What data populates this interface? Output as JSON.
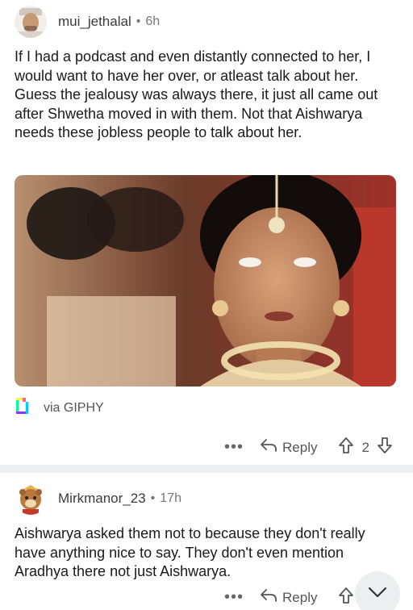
{
  "comments": [
    {
      "username": "mui_jethalal",
      "separator": "•",
      "age": "6h",
      "body": "If I had a podcast and even distantly connected to her, I would want to have her over, or atleast talk about her. Guess the jealousy was always there, it just all came out after Shwetha moved in with them. Not that Aishwarya needs these jobless people to talk about her.",
      "attachment_label": "via GIPHY",
      "more_label": "•••",
      "reply_label": "Reply",
      "vote_count": "2"
    },
    {
      "username": "Mirkmanor_23",
      "separator": "•",
      "age": "17h",
      "body": "Aishwarya asked them not to because they don't really have anything nice to say. They don't even mention Aradhya there not just Aishwarya.",
      "more_label": "•••",
      "reply_label": "Reply"
    }
  ],
  "icons": {
    "reply": "reply-arrow-icon",
    "upvote": "upvote-arrow-icon",
    "downvote": "downvote-arrow-icon",
    "giphy": "giphy-logo-icon",
    "scroll": "chevron-down-icon"
  },
  "colors": {
    "text": "#1a1a1b",
    "meta": "#777777",
    "divider": "#edeff1"
  }
}
